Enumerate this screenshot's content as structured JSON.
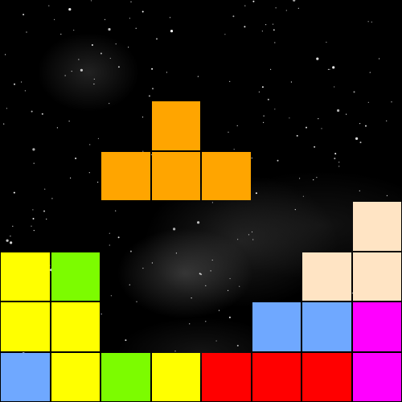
{
  "game": {
    "cell_size": 62.5,
    "columns": 8,
    "rows": 8,
    "background": "starfield-nebula",
    "colors": {
      "orange": "#FFA500",
      "yellow": "#FFFF00",
      "lime": "#7CFC00",
      "blue": "#6FA8FF",
      "red": "#FF0000",
      "peach": "#FFE4C4",
      "magenta": "#FF00FF"
    },
    "active_piece": {
      "shape": "T",
      "color": "orange",
      "cells": [
        [
          3,
          2
        ],
        [
          2,
          3
        ],
        [
          3,
          3
        ],
        [
          4,
          3
        ]
      ]
    },
    "settled_cells": [
      {
        "col": 7,
        "row": 4,
        "color": "peach"
      },
      {
        "col": 0,
        "row": 5,
        "color": "yellow"
      },
      {
        "col": 1,
        "row": 5,
        "color": "lime"
      },
      {
        "col": 6,
        "row": 5,
        "color": "peach"
      },
      {
        "col": 7,
        "row": 5,
        "color": "peach"
      },
      {
        "col": 0,
        "row": 6,
        "color": "yellow"
      },
      {
        "col": 1,
        "row": 6,
        "color": "yellow"
      },
      {
        "col": 5,
        "row": 6,
        "color": "blue"
      },
      {
        "col": 6,
        "row": 6,
        "color": "blue"
      },
      {
        "col": 7,
        "row": 6,
        "color": "magenta"
      },
      {
        "col": 0,
        "row": 7,
        "color": "blue"
      },
      {
        "col": 1,
        "row": 7,
        "color": "yellow"
      },
      {
        "col": 2,
        "row": 7,
        "color": "lime"
      },
      {
        "col": 3,
        "row": 7,
        "color": "yellow"
      },
      {
        "col": 4,
        "row": 7,
        "color": "red"
      },
      {
        "col": 5,
        "row": 7,
        "color": "red"
      },
      {
        "col": 6,
        "row": 7,
        "color": "red"
      },
      {
        "col": 7,
        "row": 7,
        "color": "magenta"
      }
    ]
  }
}
